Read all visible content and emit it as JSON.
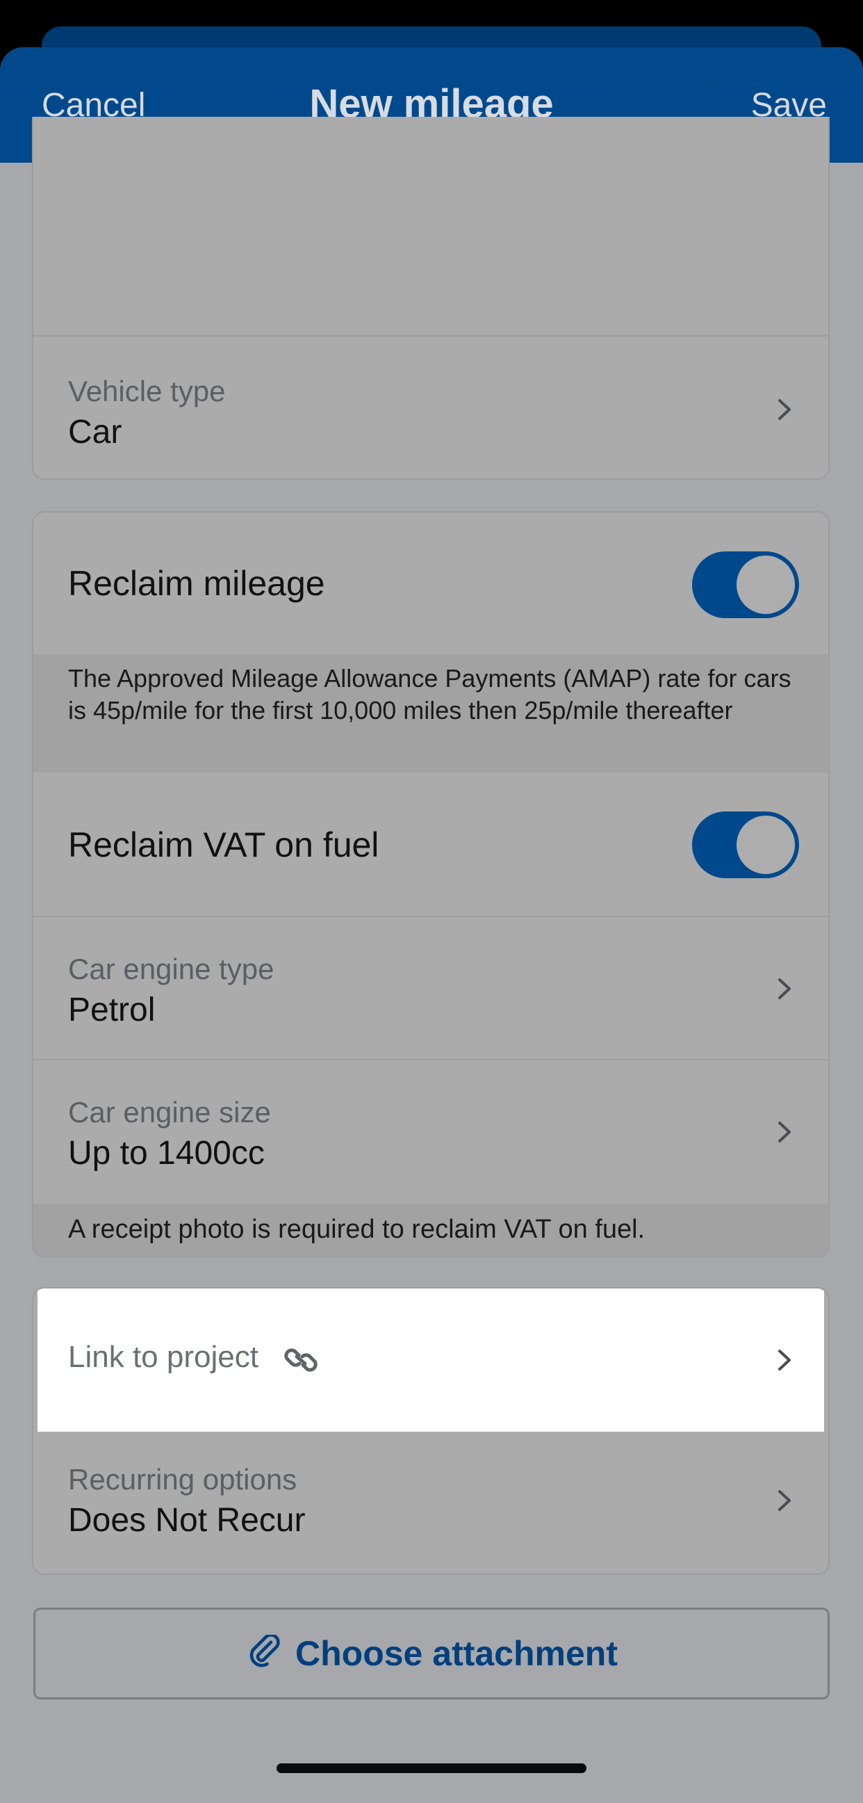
{
  "navbar": {
    "cancel_label": "Cancel",
    "title": "New mileage",
    "save_label": "Save"
  },
  "vehicle": {
    "label": "Vehicle type",
    "value": "Car"
  },
  "reclaim": {
    "mileage_label": "Reclaim mileage",
    "mileage_on": true,
    "amap_info": "The Approved Mileage Allowance Payments (AMAP) rate for cars is 45p/mile for the first 10,000 miles then 25p/mile thereafter",
    "vat_label": "Reclaim VAT on fuel",
    "vat_on": true,
    "engine_type_label": "Car engine type",
    "engine_type_value": "Petrol",
    "engine_size_label": "Car engine size",
    "engine_size_value": "Up to 1400cc",
    "receipt_info": "A receipt photo is required to reclaim VAT on fuel."
  },
  "project": {
    "link_label": "Link to project",
    "recurring_label": "Recurring options",
    "recurring_value": "Does Not Recur"
  },
  "attachment": {
    "label": "Choose attachment"
  },
  "colors": {
    "brand_blue": "#00488c",
    "backdrop_gray": "#a7a8ab"
  },
  "icons": {
    "chevron": "chevron-right-icon",
    "link": "link-icon",
    "paperclip": "paperclip-icon"
  }
}
